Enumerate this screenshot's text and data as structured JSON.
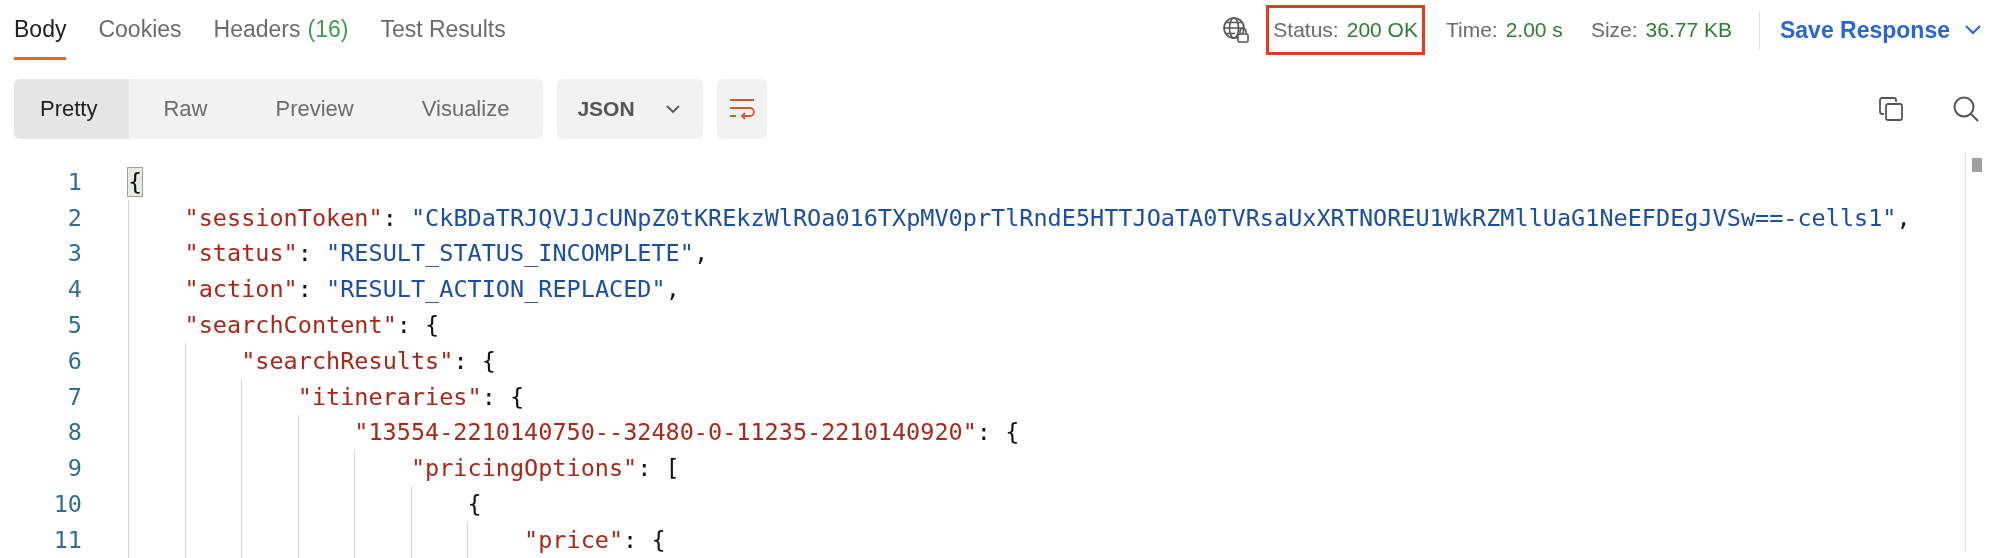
{
  "response_tabs": [
    {
      "label": "Body",
      "selected": true
    },
    {
      "label": "Cookies",
      "selected": false
    },
    {
      "label": "Headers",
      "count": "(16)",
      "selected": false
    },
    {
      "label": "Test Results",
      "selected": false
    }
  ],
  "metrics": [
    {
      "label": "Status:",
      "value": "200 OK",
      "highlighted": true
    },
    {
      "label": "Time:",
      "value": "2.00 s",
      "highlighted": false
    },
    {
      "label": "Size:",
      "value": "36.77 KB",
      "highlighted": false
    }
  ],
  "save_button": "Save Response",
  "view_tabs": [
    {
      "label": "Pretty",
      "selected": true
    },
    {
      "label": "Raw",
      "selected": false
    },
    {
      "label": "Preview",
      "selected": false
    },
    {
      "label": "Visualize",
      "selected": false
    }
  ],
  "format_dropdown": {
    "value": "JSON"
  },
  "wrap_lines": {
    "on": true
  },
  "code": [
    {
      "number": "1",
      "tokens": [
        {
          "kind": "punct",
          "text": "{",
          "highlighted": true
        }
      ],
      "children": [
        {
          "number": "2",
          "tokens": [
            {
              "kind": "key",
              "text": "\"sessionToken\""
            },
            {
              "kind": "punct",
              "text": ": "
            },
            {
              "kind": "string",
              "text": "\"CkBDaTRJQVJJcUNpZ0tKREkzWlROa016TXpMV0prTlRndE5HTTJOaTA0TVRsaUxXRTNOREU1WkRZMllUaG1NeEFDEgJVSw==-cells1\""
            },
            {
              "kind": "punct",
              "text": ","
            }
          ]
        },
        {
          "number": "3",
          "tokens": [
            {
              "kind": "key",
              "text": "\"status\""
            },
            {
              "kind": "punct",
              "text": ": "
            },
            {
              "kind": "string",
              "text": "\"RESULT_STATUS_INCOMPLETE\""
            },
            {
              "kind": "punct",
              "text": ","
            }
          ]
        },
        {
          "number": "4",
          "tokens": [
            {
              "kind": "key",
              "text": "\"action\""
            },
            {
              "kind": "punct",
              "text": ": "
            },
            {
              "kind": "string",
              "text": "\"RESULT_ACTION_REPLACED\""
            },
            {
              "kind": "punct",
              "text": ","
            }
          ]
        },
        {
          "number": "5",
          "tokens": [
            {
              "kind": "key",
              "text": "\"searchContent\""
            },
            {
              "kind": "punct",
              "text": ": {"
            }
          ],
          "children": [
            {
              "number": "6",
              "tokens": [
                {
                  "kind": "key",
                  "text": "\"searchResults\""
                },
                {
                  "kind": "punct",
                  "text": ": {"
                }
              ],
              "children": [
                {
                  "number": "7",
                  "tokens": [
                    {
                      "kind": "key",
                      "text": "\"itineraries\""
                    },
                    {
                      "kind": "punct",
                      "text": ": {"
                    }
                  ],
                  "children": [
                    {
                      "number": "8",
                      "tokens": [
                        {
                          "kind": "key",
                          "text": "\"13554-2210140750--32480-0-11235-2210140920\""
                        },
                        {
                          "kind": "punct",
                          "text": ": {"
                        }
                      ],
                      "children": [
                        {
                          "number": "9",
                          "tokens": [
                            {
                              "kind": "key",
                              "text": "\"pricingOptions\""
                            },
                            {
                              "kind": "punct",
                              "text": ": ["
                            }
                          ],
                          "children": [
                            {
                              "number": "10",
                              "tokens": [
                                {
                                  "kind": "punct",
                                  "text": "{"
                                }
                              ],
                              "children": [
                                {
                                  "number": "11",
                                  "tokens": [
                                    {
                                      "kind": "key",
                                      "text": "\"price\""
                                    },
                                    {
                                      "kind": "punct",
                                      "text": ": {"
                                    }
                                  ]
                                }
                              ]
                            }
                          ]
                        }
                      ]
                    }
                  ]
                }
              ]
            }
          ]
        }
      ]
    }
  ]
}
